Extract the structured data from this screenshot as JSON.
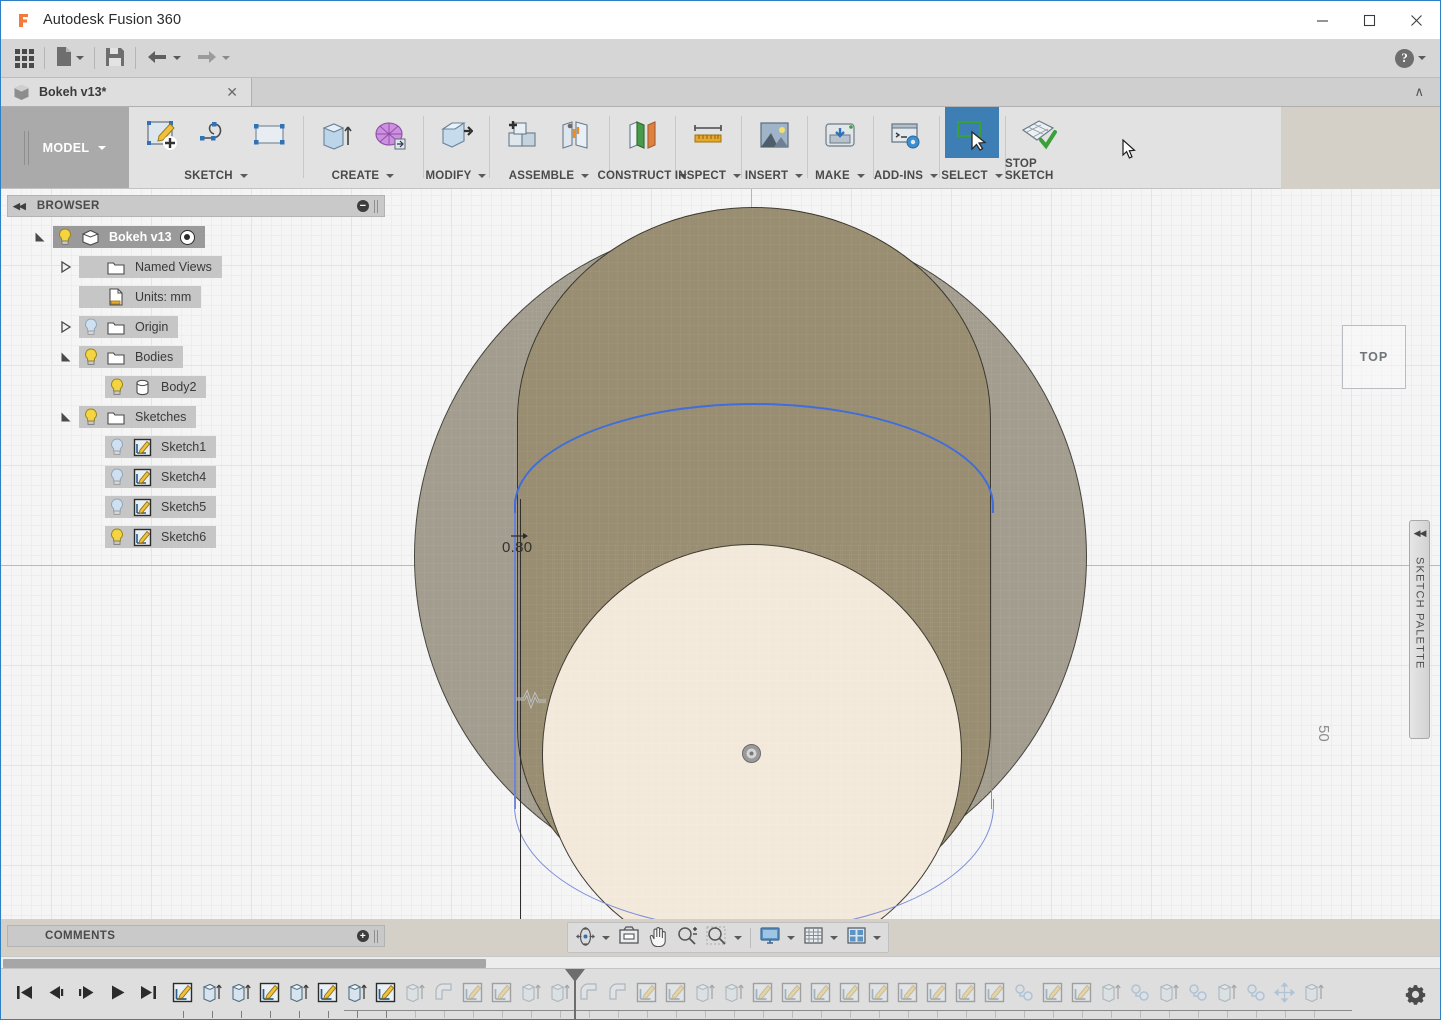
{
  "window": {
    "title": "Autodesk Fusion 360",
    "logo_icon": "fusion-logo-icon",
    "minimize_label": "—",
    "maximize_label": "□",
    "close_label": "✕"
  },
  "quick_access": {
    "items": [
      {
        "name": "app-grid-button",
        "icon": "grid-apps-icon",
        "caret": false
      },
      {
        "name": "new-file-button",
        "icon": "file-new-icon",
        "caret": true
      },
      {
        "name": "save-button",
        "icon": "save-floppy-icon",
        "caret": false
      },
      {
        "name": "undo-button",
        "icon": "undo-arrow-icon",
        "caret": true
      },
      {
        "name": "redo-button",
        "icon": "redo-arrow-icon",
        "caret": true
      }
    ],
    "help_label": "?",
    "help_icon": "help-circle-icon"
  },
  "document_tab": {
    "name": "Bokeh v13*",
    "icon": "document-cube-icon",
    "close_label": "✕",
    "collapse_label": "∧"
  },
  "ribbon": {
    "workspace": "MODEL",
    "groups": [
      {
        "label": "SKETCH",
        "name": "sketch",
        "buttons": [
          {
            "name": "create-sketch-button",
            "icon": "create-sketch-icon"
          },
          {
            "name": "spline-button",
            "icon": "spline-curve-icon"
          },
          {
            "name": "rectangle-button",
            "icon": "rectangle-icon"
          }
        ]
      },
      {
        "label": "CREATE",
        "name": "create",
        "buttons": [
          {
            "name": "extrude-button",
            "icon": "extrude-icon"
          },
          {
            "name": "form-button",
            "icon": "form-mesh-icon"
          }
        ]
      },
      {
        "label": "MODIFY",
        "name": "modify",
        "buttons": [
          {
            "name": "press-pull-button",
            "icon": "press-pull-icon"
          }
        ]
      },
      {
        "label": "ASSEMBLE",
        "name": "assemble",
        "buttons": [
          {
            "name": "new-component-button",
            "icon": "new-component-icon"
          },
          {
            "name": "joint-button",
            "icon": "joint-icon"
          }
        ]
      },
      {
        "label": "CONSTRUCT",
        "name": "construct",
        "buttons": [
          {
            "name": "offset-plane-button",
            "icon": "offset-plane-icon"
          }
        ]
      },
      {
        "label": "INSPECT",
        "name": "inspect",
        "buttons": [
          {
            "name": "measure-button",
            "icon": "measure-ruler-icon"
          }
        ]
      },
      {
        "label": "INSERT",
        "name": "insert",
        "buttons": [
          {
            "name": "insert-image-button",
            "icon": "insert-image-icon"
          }
        ]
      },
      {
        "label": "MAKE",
        "name": "make",
        "buttons": [
          {
            "name": "3d-print-button",
            "icon": "3d-print-icon"
          }
        ]
      },
      {
        "label": "ADD-INS",
        "name": "add-ins",
        "buttons": [
          {
            "name": "scripts-addins-button",
            "icon": "script-console-icon"
          }
        ]
      },
      {
        "label": "SELECT",
        "name": "select",
        "active": true,
        "buttons": [
          {
            "name": "select-tool-button",
            "icon": "select-cursor-icon"
          }
        ]
      },
      {
        "label": "STOP SKETCH",
        "name": "stop-sketch",
        "no_caret": true,
        "buttons": [
          {
            "name": "stop-sketch-button",
            "icon": "stop-sketch-icon"
          }
        ]
      }
    ]
  },
  "browser": {
    "title": "BROWSER",
    "collapse_icon": "double-left-arrow-icon",
    "minimize_icon": "minus-circle-icon",
    "tree": [
      {
        "label": "Bokeh v13",
        "indent": 0,
        "expander": "expanded",
        "bulb": "on",
        "icon": "component-cube-icon",
        "selected": true,
        "radio": true
      },
      {
        "label": "Named Views",
        "indent": 1,
        "expander": "collapsed",
        "bulb": "none",
        "icon": "folder-icon",
        "selected": false,
        "radio": false
      },
      {
        "label": "Units: mm",
        "indent": 1,
        "expander": "none",
        "bulb": "none",
        "icon": "units-document-icon",
        "selected": false,
        "radio": false
      },
      {
        "label": "Origin",
        "indent": 1,
        "expander": "collapsed",
        "bulb": "off",
        "icon": "folder-icon",
        "selected": false,
        "radio": false
      },
      {
        "label": "Bodies",
        "indent": 1,
        "expander": "expanded",
        "bulb": "on",
        "icon": "folder-icon",
        "selected": false,
        "radio": false
      },
      {
        "label": "Body2",
        "indent": 2,
        "expander": "none",
        "bulb": "on",
        "icon": "body-cylinder-icon",
        "selected": false,
        "radio": false
      },
      {
        "label": "Sketches",
        "indent": 1,
        "expander": "expanded",
        "bulb": "on",
        "icon": "folder-icon",
        "selected": false,
        "radio": false
      },
      {
        "label": "Sketch1",
        "indent": 2,
        "expander": "none",
        "bulb": "off",
        "icon": "sketch-icon",
        "selected": false,
        "radio": false
      },
      {
        "label": "Sketch4",
        "indent": 2,
        "expander": "none",
        "bulb": "off",
        "icon": "sketch-icon",
        "selected": false,
        "radio": false
      },
      {
        "label": "Sketch5",
        "indent": 2,
        "expander": "none",
        "bulb": "off",
        "icon": "sketch-icon",
        "selected": false,
        "radio": false
      },
      {
        "label": "Sketch6",
        "indent": 2,
        "expander": "none",
        "bulb": "on",
        "icon": "sketch-icon",
        "selected": false,
        "radio": false
      }
    ]
  },
  "comments": {
    "title": "COMMENTS",
    "add_icon": "plus-circle-icon"
  },
  "canvas": {
    "dimension_value": "0.80",
    "scale_label": "50",
    "viewcube_label": "TOP",
    "origin_icon": "origin-point-icon",
    "weld_icon": "coincident-constraint-icon",
    "colors": {
      "outer_body": "#a39d8f",
      "profile_face": "#998d72",
      "inner_face": "#f3e9db",
      "highlight_edge": "#3f6ddb",
      "x_axis": "#e8a6a6",
      "y_axis": "#8ad48a",
      "background": "#f5f5f5"
    }
  },
  "sketch_palette": {
    "label": "SKETCH PALETTE",
    "collapse_icon": "double-left-arrow-icon"
  },
  "navbar": {
    "buttons": [
      {
        "name": "orbit-button",
        "icon": "orbit-icon",
        "caret": true
      },
      {
        "name": "look-at-button",
        "icon": "look-at-icon",
        "caret": false
      },
      {
        "name": "pan-button",
        "icon": "pan-hand-icon",
        "caret": false
      },
      {
        "name": "zoom-button",
        "icon": "zoom-magnifier-icon",
        "caret": false
      },
      {
        "name": "fit-button",
        "icon": "fit-magnifier-icon",
        "caret": true
      },
      {
        "name": "display-settings-button",
        "icon": "display-monitor-icon",
        "caret": true,
        "sep_before": true
      },
      {
        "name": "grid-snaps-button",
        "icon": "grid-icon",
        "caret": true
      },
      {
        "name": "viewports-button",
        "icon": "viewports-icon",
        "caret": true
      }
    ]
  },
  "timeline": {
    "playback": [
      {
        "name": "go-to-beginning-button",
        "icon": "skip-to-start-icon"
      },
      {
        "name": "step-back-button",
        "icon": "step-back-icon"
      },
      {
        "name": "step-forward-button",
        "icon": "step-forward-icon"
      },
      {
        "name": "play-button",
        "icon": "play-icon"
      },
      {
        "name": "go-to-end-button",
        "icon": "skip-to-end-icon"
      }
    ],
    "settings_icon": "gear-icon",
    "features": [
      {
        "icon": "sketch-icon",
        "state": "past"
      },
      {
        "icon": "extrude-icon",
        "state": "past"
      },
      {
        "icon": "extrude-icon",
        "state": "past"
      },
      {
        "icon": "sketch-icon",
        "state": "past"
      },
      {
        "icon": "extrude-icon",
        "state": "past"
      },
      {
        "icon": "sketch-icon",
        "state": "past"
      },
      {
        "icon": "extrude-icon",
        "state": "past"
      },
      {
        "icon": "sketch-icon",
        "state": "past"
      },
      {
        "icon": "extrude-icon",
        "state": "future"
      },
      {
        "icon": "fillet-icon",
        "state": "future"
      },
      {
        "icon": "sketch-icon",
        "state": "future"
      },
      {
        "icon": "sketch-icon",
        "state": "future"
      },
      {
        "icon": "extrude-icon",
        "state": "future"
      },
      {
        "icon": "extrude-icon",
        "state": "future"
      },
      {
        "icon": "fillet-icon",
        "state": "future"
      },
      {
        "icon": "fillet-icon",
        "state": "future"
      },
      {
        "icon": "sketch-icon",
        "state": "future"
      },
      {
        "icon": "sketch-icon",
        "state": "future"
      },
      {
        "icon": "extrude-icon",
        "state": "future"
      },
      {
        "icon": "extrude-icon",
        "state": "future"
      },
      {
        "icon": "sketch-icon",
        "state": "future"
      },
      {
        "icon": "sketch-icon",
        "state": "future"
      },
      {
        "icon": "sketch-icon",
        "state": "future"
      },
      {
        "icon": "sketch-icon",
        "state": "future"
      },
      {
        "icon": "sketch-icon",
        "state": "future"
      },
      {
        "icon": "sketch-icon",
        "state": "future"
      },
      {
        "icon": "sketch-icon",
        "state": "future"
      },
      {
        "icon": "sketch-icon",
        "state": "future"
      },
      {
        "icon": "sketch-icon",
        "state": "future"
      },
      {
        "icon": "joint-icon",
        "state": "future"
      },
      {
        "icon": "sketch-icon",
        "state": "future"
      },
      {
        "icon": "sketch-icon",
        "state": "future"
      },
      {
        "icon": "extrude-icon",
        "state": "future"
      },
      {
        "icon": "joint-icon",
        "state": "future"
      },
      {
        "icon": "extrude-icon",
        "state": "future"
      },
      {
        "icon": "joint-icon",
        "state": "future"
      },
      {
        "icon": "extrude-icon",
        "state": "future"
      },
      {
        "icon": "joint-icon",
        "state": "future"
      },
      {
        "icon": "move-icon",
        "state": "future"
      },
      {
        "icon": "extrude-icon",
        "state": "future"
      }
    ]
  }
}
